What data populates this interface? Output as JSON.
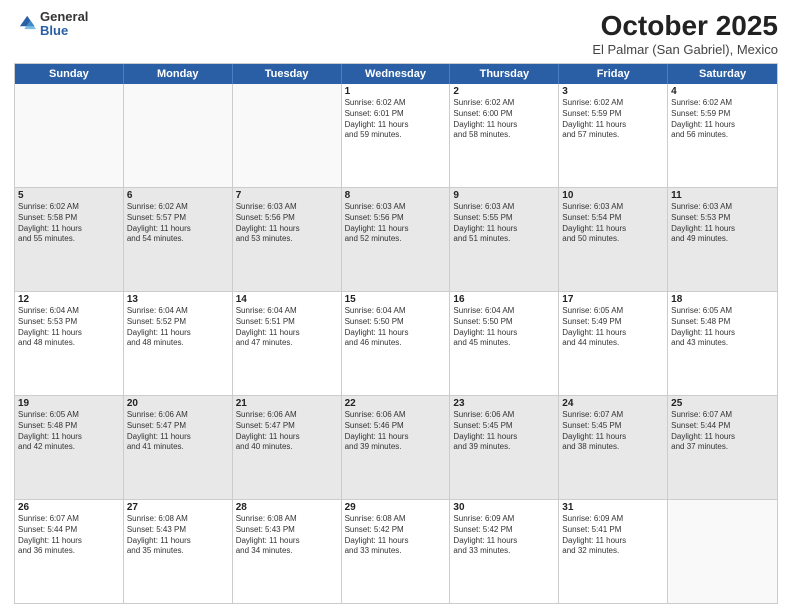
{
  "logo": {
    "general": "General",
    "blue": "Blue"
  },
  "header": {
    "month": "October 2025",
    "location": "El Palmar (San Gabriel), Mexico"
  },
  "dayHeaders": [
    "Sunday",
    "Monday",
    "Tuesday",
    "Wednesday",
    "Thursday",
    "Friday",
    "Saturday"
  ],
  "weeks": [
    [
      {
        "day": "",
        "info": ""
      },
      {
        "day": "",
        "info": ""
      },
      {
        "day": "",
        "info": ""
      },
      {
        "day": "1",
        "info": "Sunrise: 6:02 AM\nSunset: 6:01 PM\nDaylight: 11 hours\nand 59 minutes."
      },
      {
        "day": "2",
        "info": "Sunrise: 6:02 AM\nSunset: 6:00 PM\nDaylight: 11 hours\nand 58 minutes."
      },
      {
        "day": "3",
        "info": "Sunrise: 6:02 AM\nSunset: 5:59 PM\nDaylight: 11 hours\nand 57 minutes."
      },
      {
        "day": "4",
        "info": "Sunrise: 6:02 AM\nSunset: 5:59 PM\nDaylight: 11 hours\nand 56 minutes."
      }
    ],
    [
      {
        "day": "5",
        "info": "Sunrise: 6:02 AM\nSunset: 5:58 PM\nDaylight: 11 hours\nand 55 minutes."
      },
      {
        "day": "6",
        "info": "Sunrise: 6:02 AM\nSunset: 5:57 PM\nDaylight: 11 hours\nand 54 minutes."
      },
      {
        "day": "7",
        "info": "Sunrise: 6:03 AM\nSunset: 5:56 PM\nDaylight: 11 hours\nand 53 minutes."
      },
      {
        "day": "8",
        "info": "Sunrise: 6:03 AM\nSunset: 5:56 PM\nDaylight: 11 hours\nand 52 minutes."
      },
      {
        "day": "9",
        "info": "Sunrise: 6:03 AM\nSunset: 5:55 PM\nDaylight: 11 hours\nand 51 minutes."
      },
      {
        "day": "10",
        "info": "Sunrise: 6:03 AM\nSunset: 5:54 PM\nDaylight: 11 hours\nand 50 minutes."
      },
      {
        "day": "11",
        "info": "Sunrise: 6:03 AM\nSunset: 5:53 PM\nDaylight: 11 hours\nand 49 minutes."
      }
    ],
    [
      {
        "day": "12",
        "info": "Sunrise: 6:04 AM\nSunset: 5:53 PM\nDaylight: 11 hours\nand 48 minutes."
      },
      {
        "day": "13",
        "info": "Sunrise: 6:04 AM\nSunset: 5:52 PM\nDaylight: 11 hours\nand 48 minutes."
      },
      {
        "day": "14",
        "info": "Sunrise: 6:04 AM\nSunset: 5:51 PM\nDaylight: 11 hours\nand 47 minutes."
      },
      {
        "day": "15",
        "info": "Sunrise: 6:04 AM\nSunset: 5:50 PM\nDaylight: 11 hours\nand 46 minutes."
      },
      {
        "day": "16",
        "info": "Sunrise: 6:04 AM\nSunset: 5:50 PM\nDaylight: 11 hours\nand 45 minutes."
      },
      {
        "day": "17",
        "info": "Sunrise: 6:05 AM\nSunset: 5:49 PM\nDaylight: 11 hours\nand 44 minutes."
      },
      {
        "day": "18",
        "info": "Sunrise: 6:05 AM\nSunset: 5:48 PM\nDaylight: 11 hours\nand 43 minutes."
      }
    ],
    [
      {
        "day": "19",
        "info": "Sunrise: 6:05 AM\nSunset: 5:48 PM\nDaylight: 11 hours\nand 42 minutes."
      },
      {
        "day": "20",
        "info": "Sunrise: 6:06 AM\nSunset: 5:47 PM\nDaylight: 11 hours\nand 41 minutes."
      },
      {
        "day": "21",
        "info": "Sunrise: 6:06 AM\nSunset: 5:47 PM\nDaylight: 11 hours\nand 40 minutes."
      },
      {
        "day": "22",
        "info": "Sunrise: 6:06 AM\nSunset: 5:46 PM\nDaylight: 11 hours\nand 39 minutes."
      },
      {
        "day": "23",
        "info": "Sunrise: 6:06 AM\nSunset: 5:45 PM\nDaylight: 11 hours\nand 39 minutes."
      },
      {
        "day": "24",
        "info": "Sunrise: 6:07 AM\nSunset: 5:45 PM\nDaylight: 11 hours\nand 38 minutes."
      },
      {
        "day": "25",
        "info": "Sunrise: 6:07 AM\nSunset: 5:44 PM\nDaylight: 11 hours\nand 37 minutes."
      }
    ],
    [
      {
        "day": "26",
        "info": "Sunrise: 6:07 AM\nSunset: 5:44 PM\nDaylight: 11 hours\nand 36 minutes."
      },
      {
        "day": "27",
        "info": "Sunrise: 6:08 AM\nSunset: 5:43 PM\nDaylight: 11 hours\nand 35 minutes."
      },
      {
        "day": "28",
        "info": "Sunrise: 6:08 AM\nSunset: 5:43 PM\nDaylight: 11 hours\nand 34 minutes."
      },
      {
        "day": "29",
        "info": "Sunrise: 6:08 AM\nSunset: 5:42 PM\nDaylight: 11 hours\nand 33 minutes."
      },
      {
        "day": "30",
        "info": "Sunrise: 6:09 AM\nSunset: 5:42 PM\nDaylight: 11 hours\nand 33 minutes."
      },
      {
        "day": "31",
        "info": "Sunrise: 6:09 AM\nSunset: 5:41 PM\nDaylight: 11 hours\nand 32 minutes."
      },
      {
        "day": "",
        "info": ""
      }
    ]
  ]
}
